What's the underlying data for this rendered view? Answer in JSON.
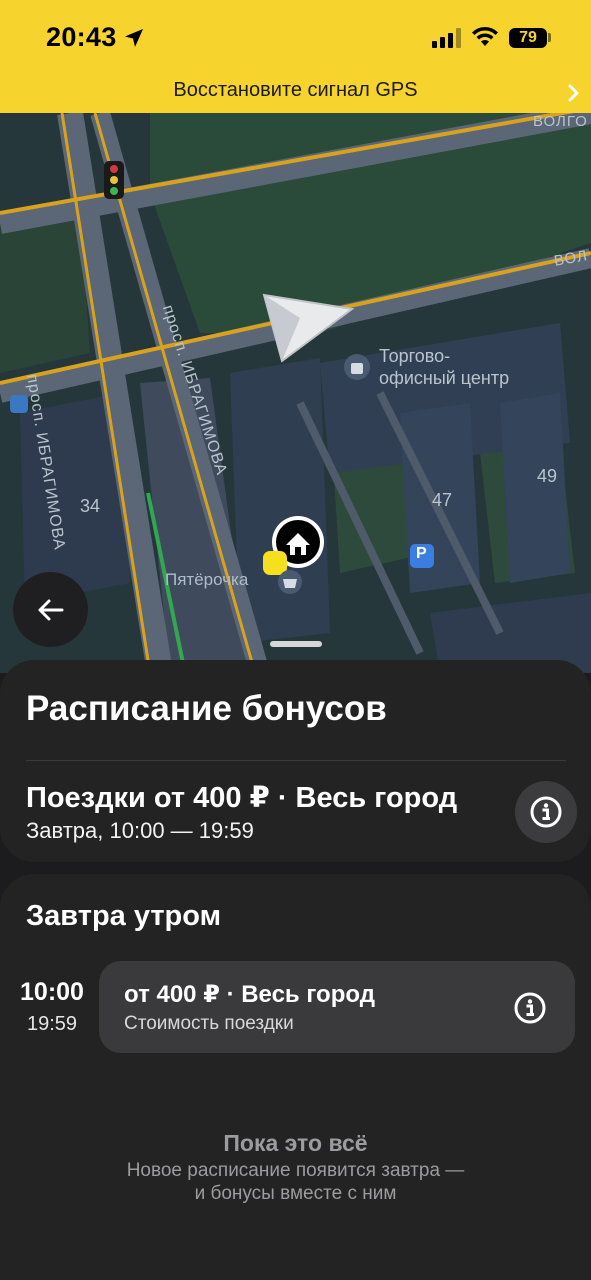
{
  "status_bar": {
    "time": "20:43",
    "battery": "79"
  },
  "gps_banner": {
    "text": "Восстановите сигнал GPS"
  },
  "map": {
    "labels": {
      "street_top_1": "ВОЛГО",
      "street_top_2": "ВОЛ",
      "avenue_left": "просп. ИБРАГИМОВА",
      "avenue_right": "просп. ИБРАГИМОВА",
      "poi_mall_line1": "Торгово-",
      "poi_mall_line2": "офисный центр",
      "house_34": "34",
      "house_47": "47",
      "house_49": "49",
      "store": "Пятёрочка",
      "parking": "P"
    }
  },
  "sheet": {
    "title": "Расписание бонусов",
    "promo": {
      "title": "Поездки от 400 ₽ · Весь город",
      "subtitle": "Завтра, 10:00 — 19:59"
    },
    "section": {
      "title": "Завтра утром",
      "slot": {
        "start": "10:00",
        "end": "19:59",
        "title": "от 400 ₽ · Весь город",
        "subtitle": "Стоимость поездки"
      }
    },
    "footer": {
      "title": "Пока это всё",
      "line1": "Новое расписание появится завтра —",
      "line2": "и бонусы вместе с ним"
    }
  },
  "icons": {
    "back": "arrow-left-icon",
    "info": "info-icon",
    "navigation": "navigation-arrow-icon",
    "home": "home-icon"
  }
}
